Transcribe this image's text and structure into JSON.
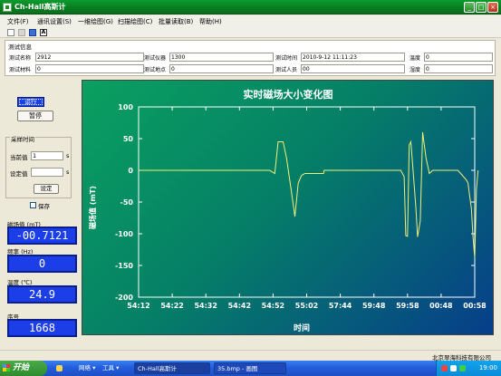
{
  "window": {
    "title": "Ch-Hall高斯计"
  },
  "menu": [
    "文件(F)",
    "通讯设置(S)",
    "一维绘图(G)",
    "扫描绘图(C)",
    "批量读取(B)",
    "帮助(H)"
  ],
  "info": {
    "group_title": "测试信息",
    "fields": [
      {
        "label": "测试名称",
        "value": "2912"
      },
      {
        "label": "测试仪器",
        "value": "1300"
      },
      {
        "label": "测试时间",
        "value": "2010-9-12 11:11:23"
      },
      {
        "label": "温度",
        "value": "0"
      },
      {
        "label": "测试材料",
        "value": "0"
      },
      {
        "label": "测试地点",
        "value": "0"
      },
      {
        "label": "测试人员",
        "value": "00"
      },
      {
        "label": "湿度",
        "value": "0"
      }
    ]
  },
  "controls": {
    "run_label": "运行",
    "pause_label": "暂停",
    "sampling_title": "采样时间",
    "current_label": "当前值",
    "current_value": "1",
    "set_label": "设定值",
    "set_value": "",
    "unit": "s",
    "set_button": "设定",
    "save_label": "保存"
  },
  "readouts": {
    "field": {
      "label": "磁场值 (mT)",
      "value": "-00.7121"
    },
    "freq": {
      "label": "频率 (Hz)",
      "value": "0"
    },
    "temp": {
      "label": "温度 (℃)",
      "value": "24.9"
    },
    "seq": {
      "label": "序号",
      "value": "1668"
    }
  },
  "chart_data": {
    "type": "line",
    "title": "实时磁场大小变化图",
    "xlabel": "时间",
    "ylabel": "磁场值 (mT)",
    "ylim": [
      -200,
      100
    ],
    "yticks": [
      "100",
      "50",
      "0",
      "-50",
      "-100",
      "-150",
      "-200"
    ],
    "xticks": [
      "54:12",
      "54:22",
      "54:32",
      "54:42",
      "54:52",
      "55:02",
      "57:44",
      "59:48",
      "59:58",
      "00:48",
      "00:58"
    ],
    "line_color": "#f0f07a",
    "series": [
      {
        "points": [
          [
            0,
            0
          ],
          [
            3.9,
            0
          ],
          [
            4.05,
            -5
          ],
          [
            4.15,
            45
          ],
          [
            4.3,
            45
          ],
          [
            4.4,
            20
          ],
          [
            4.55,
            -35
          ],
          [
            4.65,
            -73
          ],
          [
            4.75,
            -20
          ],
          [
            4.85,
            -8
          ],
          [
            4.95,
            -5
          ],
          [
            5.1,
            -5
          ],
          [
            5.5,
            -5
          ],
          [
            5.52,
            0
          ],
          [
            5.6,
            0
          ],
          [
            7.8,
            0
          ],
          [
            7.9,
            -10
          ],
          [
            7.95,
            -103
          ],
          [
            8.0,
            -104
          ],
          [
            8.05,
            40
          ],
          [
            8.1,
            45
          ],
          [
            8.15,
            10
          ],
          [
            8.25,
            -60
          ],
          [
            8.3,
            -105
          ],
          [
            8.38,
            -80
          ],
          [
            8.45,
            60
          ],
          [
            8.55,
            20
          ],
          [
            8.65,
            -5
          ],
          [
            8.75,
            0
          ],
          [
            9.5,
            0
          ],
          [
            9.75,
            -15
          ],
          [
            9.8,
            -20
          ],
          [
            9.85,
            -40
          ],
          [
            9.9,
            -60
          ],
          [
            9.95,
            -105
          ],
          [
            10.0,
            -138
          ],
          [
            10.05,
            -30
          ],
          [
            10.1,
            0
          ]
        ]
      }
    ]
  },
  "status": {
    "company": "北京翠海科技有限公司"
  },
  "taskbar": {
    "start_label": "开始",
    "items": [
      "网络 ▾",
      "工具 ▾",
      "Ch-Hall高斯计",
      "35.bmp - 画图"
    ],
    "clock": "19:00"
  }
}
